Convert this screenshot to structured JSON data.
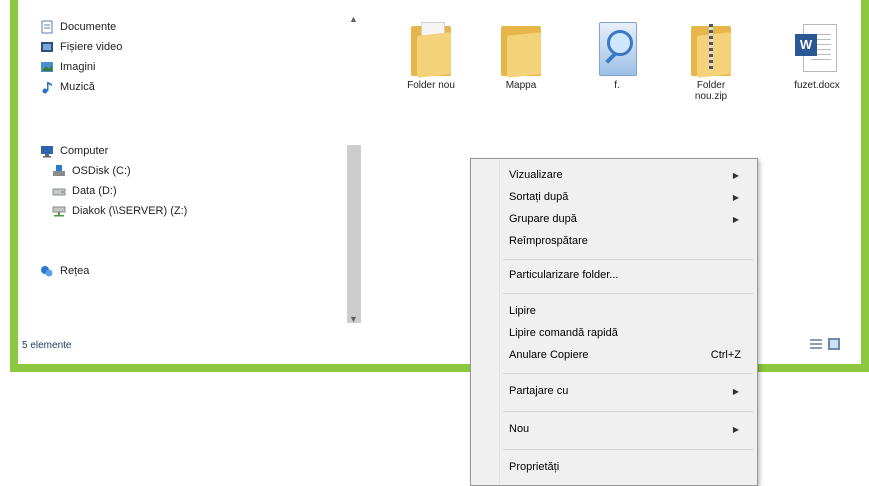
{
  "navigation": {
    "items": [
      {
        "label": "Documente",
        "icon": "document-library-icon"
      },
      {
        "label": "Fișiere video",
        "icon": "video-library-icon"
      },
      {
        "label": "Imagini",
        "icon": "pictures-library-icon"
      },
      {
        "label": "Muzică",
        "icon": "music-library-icon"
      },
      {
        "label": "Computer",
        "icon": "computer-icon"
      },
      {
        "label": "OSDisk (C:)",
        "icon": "drive-c-icon"
      },
      {
        "label": "Data (D:)",
        "icon": "drive-d-icon"
      },
      {
        "label": "Diakok (\\\\SERVER) (Z:)",
        "icon": "network-drive-icon"
      },
      {
        "label": "Rețea",
        "icon": "network-icon"
      }
    ]
  },
  "files": [
    {
      "label": "Folder nou",
      "type": "folder"
    },
    {
      "label": "Mappa",
      "type": "folder"
    },
    {
      "label": "f.",
      "type": "search-file"
    },
    {
      "label": "Folder nou.zip",
      "type": "zip-folder"
    },
    {
      "label": "fuzet.docx",
      "type": "word-document"
    }
  ],
  "status": {
    "item_count": "5 elemente"
  },
  "context_menu": {
    "items": [
      {
        "label": "Vizualizare",
        "submenu": true
      },
      {
        "label": "Sortați după",
        "submenu": true
      },
      {
        "label": "Grupare după",
        "submenu": true
      },
      {
        "label": "Reîmprospătare"
      },
      {
        "label": "Particularizare folder..."
      },
      {
        "label": "Lipire"
      },
      {
        "label": "Lipire comandă rapidă"
      },
      {
        "label": "Anulare Copiere",
        "shortcut": "Ctrl+Z"
      },
      {
        "label": "Partajare cu",
        "submenu": true
      },
      {
        "label": "Nou",
        "submenu": true
      },
      {
        "label": "Proprietăți"
      }
    ]
  },
  "colors": {
    "frame": "#8dc63f",
    "folder": "#e7b64a",
    "word": "#2b5797"
  }
}
